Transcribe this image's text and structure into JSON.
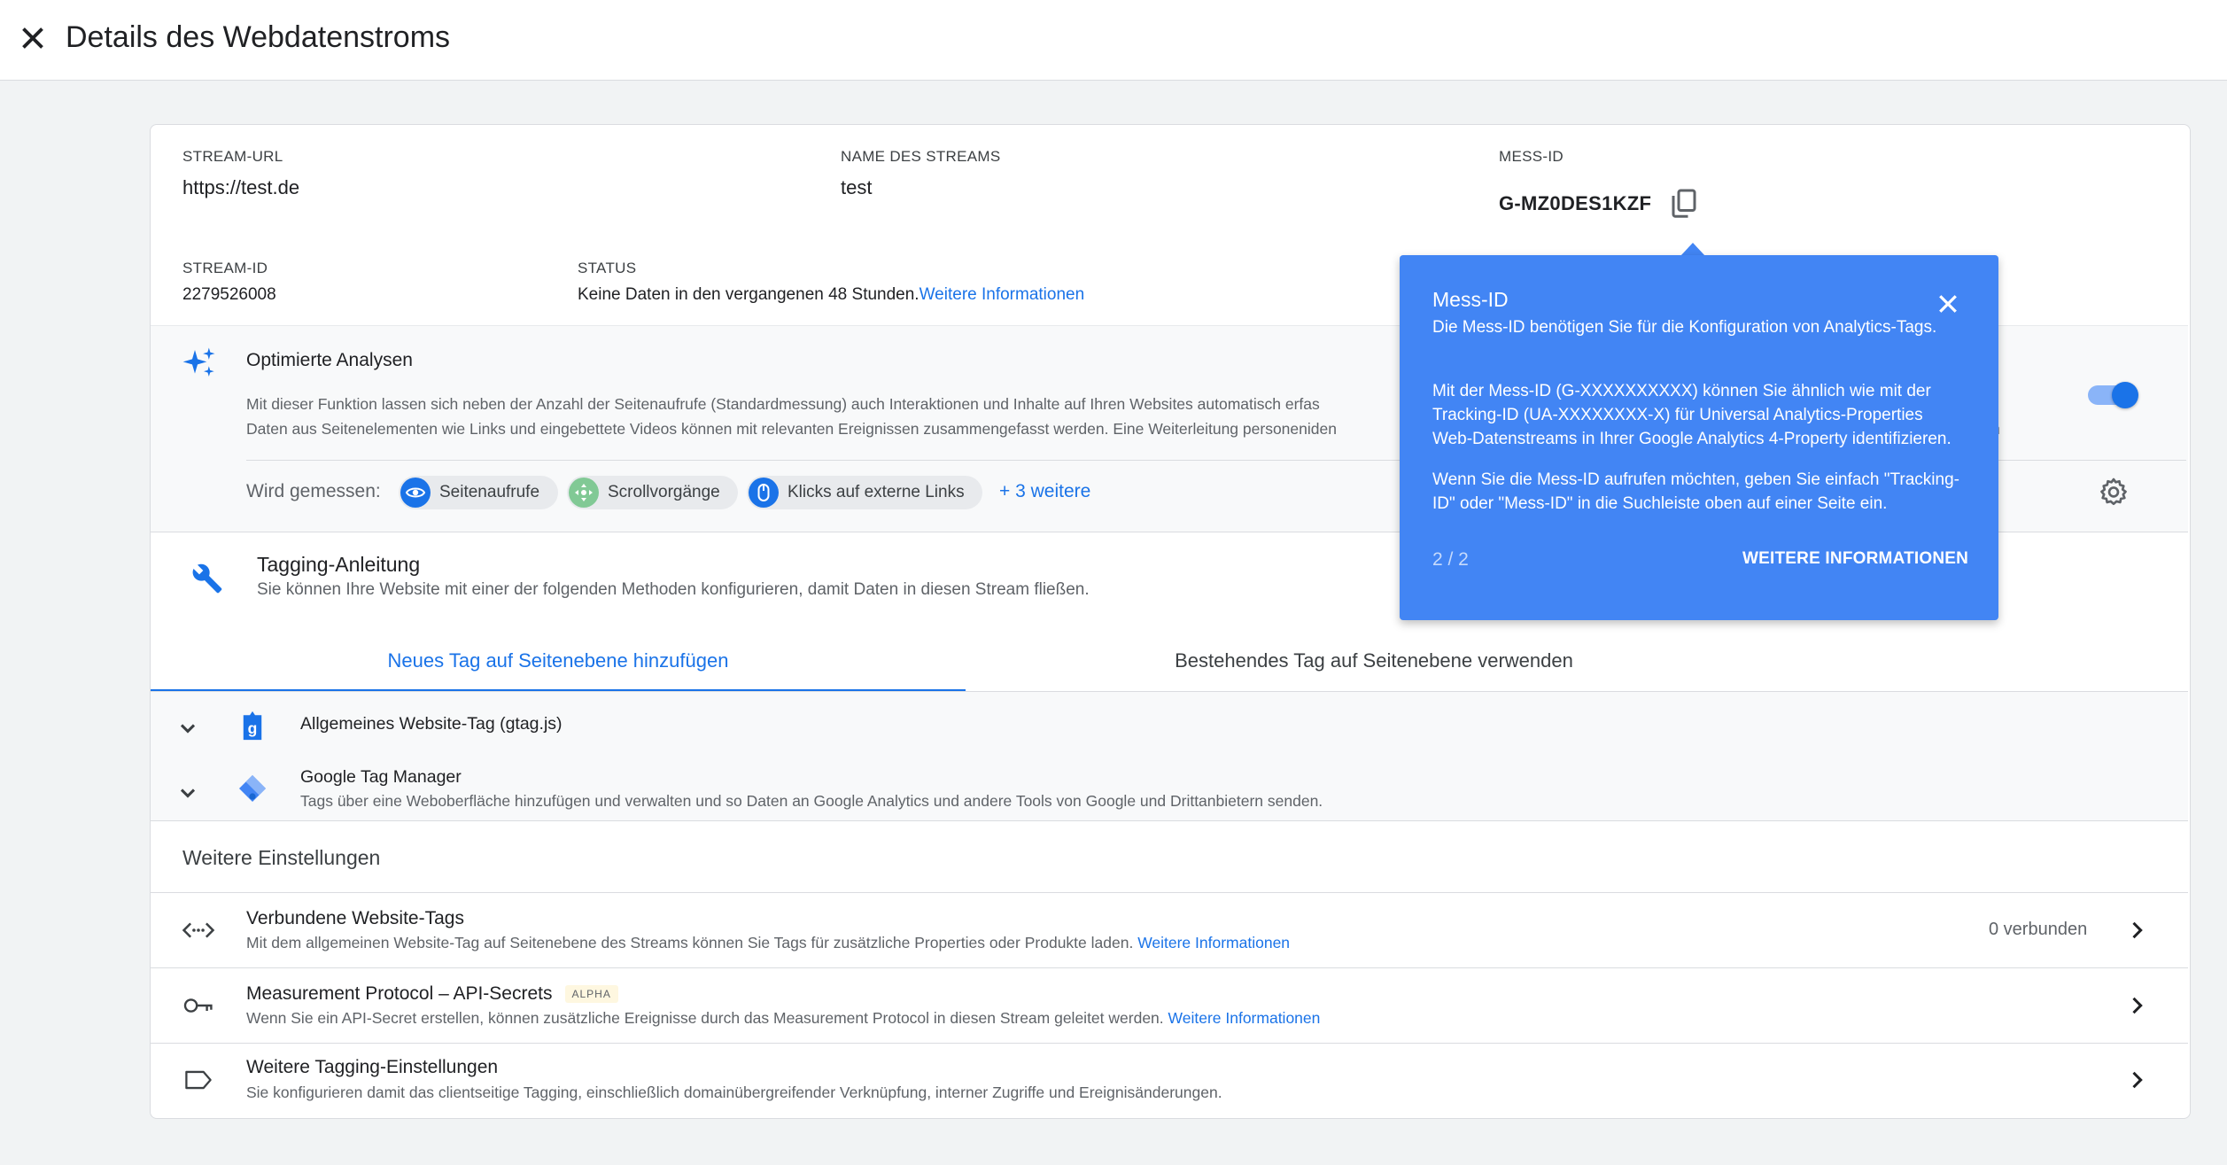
{
  "header": {
    "title": "Details des Webdatenstroms"
  },
  "stream": {
    "url_label": "STREAM-URL",
    "url_value": "https://test.de",
    "name_label": "NAME DES STREAMS",
    "name_value": "test",
    "mess_label": "MESS-ID",
    "mess_value": "G-MZ0DES1KZF",
    "id_label": "STREAM-ID",
    "id_value": "2279526008",
    "status_label": "STATUS",
    "status_value": "Keine Daten in den vergangenen 48 Stunden.",
    "status_link": "Weitere Informationen"
  },
  "enhanced": {
    "title": "Optimierte Analysen",
    "desc1": "Mit dieser Funktion lassen sich neben der Anzahl der Seitenaufrufe (Standardmessung) auch Interaktionen und Inhalte auf Ihren Websites automatisch erfas",
    "desc2": "Daten aus Seitenelementen wie Links und eingebettete Videos können mit relevanten Ereignissen zusammengefasst werden. Eine Weiterleitung personeniden",
    "desc2_tail": "n",
    "measured_label": "Wird gemessen:",
    "chips": [
      "Seitenaufrufe",
      "Scrollvorgänge",
      "Klicks auf externe Links"
    ],
    "more": "+ 3 weitere",
    "toggle_on": true
  },
  "tagging": {
    "title": "Tagging-Anleitung",
    "subtitle": "Sie können Ihre Website mit einer der folgenden Methoden konfigurieren, damit Daten in diesen Stream fließen.",
    "tabs": [
      "Neues Tag auf Seitenebene hinzufügen",
      "Bestehendes Tag auf Seitenebene verwenden"
    ],
    "active_tab": 0,
    "items": [
      {
        "title": "Allgemeines Website-Tag (gtag.js)"
      },
      {
        "title": "Google Tag Manager",
        "desc": "Tags über eine Weboberfläche hinzufügen und verwalten und so Daten an Google Analytics und andere Tools von Google und Drittanbietern senden."
      }
    ]
  },
  "settings": {
    "title": "Weitere Einstellungen",
    "rows": [
      {
        "title": "Verbundene Website-Tags",
        "desc": "Mit dem allgemeinen Website-Tag auf Seitenebene des Streams können Sie Tags für zusätzliche Properties oder Produkte laden.",
        "link": "Weitere Informationen",
        "meta": "0 verbunden"
      },
      {
        "title": "Measurement Protocol – API-Secrets",
        "badge": "ALPHA",
        "desc": "Wenn Sie ein API-Secret erstellen, können zusätzliche Ereignisse durch das Measurement Protocol in diesen Stream geleitet werden.",
        "link": "Weitere Informationen"
      },
      {
        "title": "Weitere Tagging-Einstellungen",
        "desc": "Sie konfigurieren damit das clientseitige Tagging, einschließlich domainübergreifender Verknüpfung, interner Zugriffe und Ereignisänderungen."
      }
    ]
  },
  "popover": {
    "title": "Mess-ID",
    "p1": "Die Mess-ID benötigen Sie für die Konfiguration von Analytics-Tags.",
    "p2": "Mit der Mess-ID (G-XXXXXXXXXX) können Sie ähnlich wie mit der Tracking-ID (UA-XXXXXXXX-X) für Universal Analytics-Properties Web-Datenstreams in Ihrer Google Analytics 4-Property identifizieren.",
    "p3": "Wenn Sie die Mess-ID aufrufen möchten, geben Sie einfach \"Tracking-ID\" oder \"Mess-ID\" in die Suchleiste oben auf einer Seite ein.",
    "pager": "2 / 2",
    "action": "WEITERE INFORMATIONEN"
  },
  "colors": {
    "accent": "#1a73e8",
    "popover": "#4285f4",
    "background": "#f1f3f4"
  }
}
